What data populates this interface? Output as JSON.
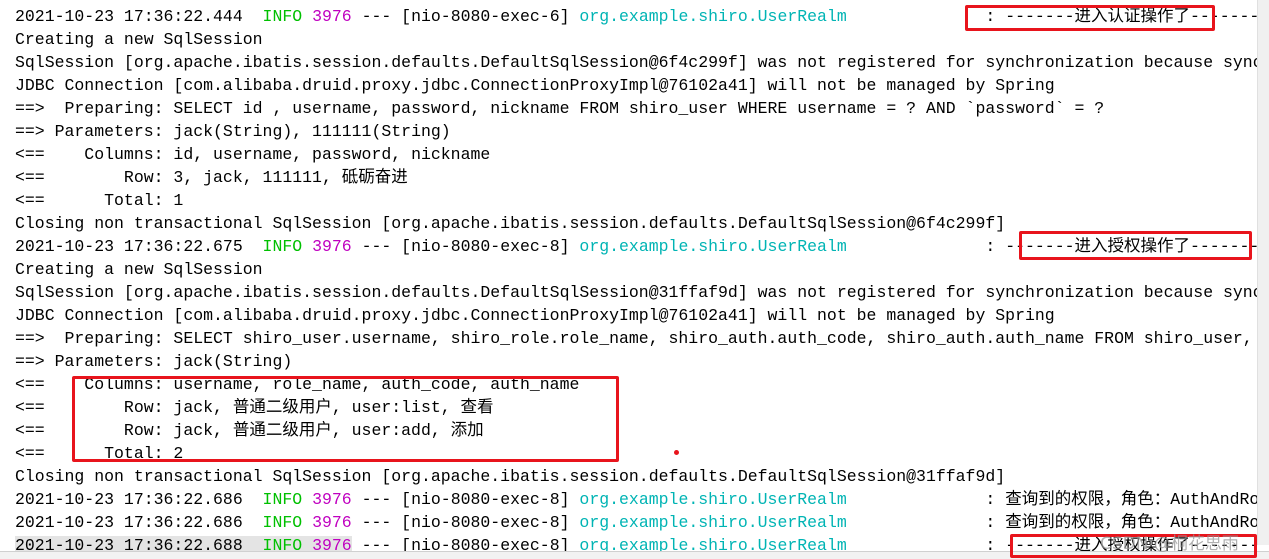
{
  "colors": {
    "info": "#00c000",
    "pid": "#c000c0",
    "logger": "#00b4b4",
    "highlight": "#e8141c"
  },
  "lines": [
    [
      {
        "t": "2021-10-23 17:36:22.444  "
      },
      {
        "t": "INFO",
        "c": "info"
      },
      {
        "t": " "
      },
      {
        "t": "3976",
        "c": "pid"
      },
      {
        "t": " --- [nio-8080-exec-6] "
      },
      {
        "t": "org.example.shiro.UserRealm",
        "c": "logger"
      },
      {
        "t": "              : -------进入认证操作了-------"
      }
    ],
    [
      {
        "t": "Creating a new SqlSession"
      }
    ],
    [
      {
        "t": "SqlSession [org.apache.ibatis.session.defaults.DefaultSqlSession@6f4c299f] was not registered for synchronization because sync"
      }
    ],
    [
      {
        "t": "JDBC Connection [com.alibaba.druid.proxy.jdbc.ConnectionProxyImpl@76102a41] will not be managed by Spring"
      }
    ],
    [
      {
        "t": "==>  Preparing: SELECT id , username, password, nickname FROM shiro_user WHERE username = ? AND `password` = ?"
      }
    ],
    [
      {
        "t": "==> Parameters: jack(String), 111111(String)"
      }
    ],
    [
      {
        "t": "<==    Columns: id, username, password, nickname"
      }
    ],
    [
      {
        "t": "<==        Row: 3, jack, 111111, 砥砺奋进"
      }
    ],
    [
      {
        "t": "<==      Total: 1"
      }
    ],
    [
      {
        "t": "Closing non transactional SqlSession [org.apache.ibatis.session.defaults.DefaultSqlSession@6f4c299f]"
      }
    ],
    [
      {
        "t": "2021-10-23 17:36:22.675  "
      },
      {
        "t": "INFO",
        "c": "info"
      },
      {
        "t": " "
      },
      {
        "t": "3976",
        "c": "pid"
      },
      {
        "t": " --- [nio-8080-exec-8] "
      },
      {
        "t": "org.example.shiro.UserRealm",
        "c": "logger"
      },
      {
        "t": "              : -------进入授权操作了-------"
      }
    ],
    [
      {
        "t": "Creating a new SqlSession"
      }
    ],
    [
      {
        "t": "SqlSession [org.apache.ibatis.session.defaults.DefaultSqlSession@31ffaf9d] was not registered for synchronization because sync"
      }
    ],
    [
      {
        "t": "JDBC Connection [com.alibaba.druid.proxy.jdbc.ConnectionProxyImpl@76102a41] will not be managed by Spring"
      }
    ],
    [
      {
        "t": "==>  Preparing: SELECT shiro_user.username, shiro_role.role_name, shiro_auth.auth_code, shiro_auth.auth_name FROM shiro_user,"
      }
    ],
    [
      {
        "t": "==> Parameters: jack(String)"
      }
    ],
    [
      {
        "t": "<==    Columns: username, role_name, auth_code, auth_name"
      }
    ],
    [
      {
        "t": "<==        Row: jack, 普通二级用户, user:list, 查看"
      }
    ],
    [
      {
        "t": "<==        Row: jack, 普通二级用户, user:add, 添加"
      }
    ],
    [
      {
        "t": "<==      Total: 2"
      }
    ],
    [
      {
        "t": "Closing non transactional SqlSession [org.apache.ibatis.session.defaults.DefaultSqlSession@31ffaf9d]"
      }
    ],
    [
      {
        "t": "2021-10-23 17:36:22.686  "
      },
      {
        "t": "INFO",
        "c": "info"
      },
      {
        "t": " "
      },
      {
        "t": "3976",
        "c": "pid"
      },
      {
        "t": " --- [nio-8080-exec-8] "
      },
      {
        "t": "org.example.shiro.UserRealm",
        "c": "logger"
      },
      {
        "t": "              : 查询到的权限，角色：AuthAndRole"
      }
    ],
    [
      {
        "t": "2021-10-23 17:36:22.686  "
      },
      {
        "t": "INFO",
        "c": "info"
      },
      {
        "t": " "
      },
      {
        "t": "3976",
        "c": "pid"
      },
      {
        "t": " --- [nio-8080-exec-8] "
      },
      {
        "t": "org.example.shiro.UserRealm",
        "c": "logger"
      },
      {
        "t": "              : 查询到的权限，角色：AuthAndRole"
      }
    ],
    [
      {
        "t": "2021-10-23 17:36:22.688  ",
        "hl": true
      },
      {
        "t": "INFO",
        "c": "info",
        "hl": true
      },
      {
        "t": " ",
        "hl": true
      },
      {
        "t": "3976",
        "c": "pid",
        "hl": true
      },
      {
        "t": " --- [nio-8080-exec-8] "
      },
      {
        "t": "org.example.shiro.UserRealm",
        "c": "logger"
      },
      {
        "t": "              : -------进入授权操作了-------"
      }
    ]
  ],
  "watermark": "CSDN @桐花思雨"
}
